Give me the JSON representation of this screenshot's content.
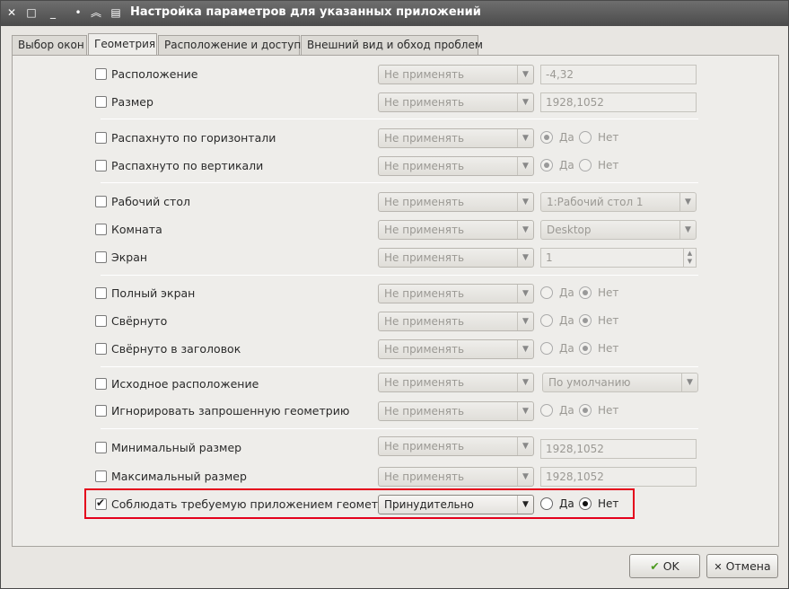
{
  "titlebar": {
    "close_glyph": "✕",
    "maximize_glyph": "□",
    "minimize_glyph": "_",
    "menu_glyph": "•",
    "shade_glyph": "︽",
    "app_icon_glyph": "▤",
    "title": "Настройка параметров для указанных приложений"
  },
  "tabs": [
    {
      "label": "Выбор окон"
    },
    {
      "label": "Геометрия"
    },
    {
      "label": "Расположение и доступ"
    },
    {
      "label": "Внешний вид и обход проблем"
    }
  ],
  "rows": {
    "position": {
      "label": "Расположение",
      "policy": "Не применять",
      "value": "-4,32"
    },
    "size": {
      "label": "Размер",
      "policy": "Не применять",
      "value": "1928,1052"
    },
    "max_horiz": {
      "label": "Распахнуто по горизонтали",
      "policy": "Не применять",
      "yes": "Да",
      "no": "Нет"
    },
    "max_vert": {
      "label": "Распахнуто по вертикали",
      "policy": "Не применять",
      "yes": "Да",
      "no": "Нет"
    },
    "desktop": {
      "label": "Рабочий стол",
      "policy": "Не применять",
      "value": "1:Рабочий стол 1"
    },
    "activity": {
      "label": "Комната",
      "policy": "Не применять",
      "value": "Desktop"
    },
    "screen": {
      "label": "Экран",
      "policy": "Не применять",
      "value": "1"
    },
    "fullscreen": {
      "label": "Полный экран",
      "policy": "Не применять",
      "yes": "Да",
      "no": "Нет"
    },
    "minimized": {
      "label": "Свёрнуто",
      "policy": "Не применять",
      "yes": "Да",
      "no": "Нет"
    },
    "shaded": {
      "label": "Свёрнуто в заголовок",
      "policy": "Не применять",
      "yes": "Да",
      "no": "Нет"
    },
    "initial_placement": {
      "label": "Исходное расположение",
      "policy": "Не применять",
      "value": "По умолчанию"
    },
    "ignore_geometry": {
      "label": "Игнорировать запрошенную геометрию",
      "policy": "Не применять",
      "yes": "Да",
      "no": "Нет"
    },
    "min_size": {
      "label": "Минимальный размер",
      "policy": "Не применять",
      "value": "1928,1052"
    },
    "max_size": {
      "label": "Максимальный размер",
      "policy": "Не применять",
      "value": "1928,1052"
    },
    "obey_geometry": {
      "label": "Соблюдать требуемую приложением геометрию",
      "policy": "Принудительно",
      "yes": "Да",
      "no": "Нет"
    }
  },
  "buttons": {
    "ok": "OK",
    "cancel": "Отмена"
  },
  "colors": {
    "highlight": "#e4001b",
    "ok_icon": "#4c9a1f"
  }
}
